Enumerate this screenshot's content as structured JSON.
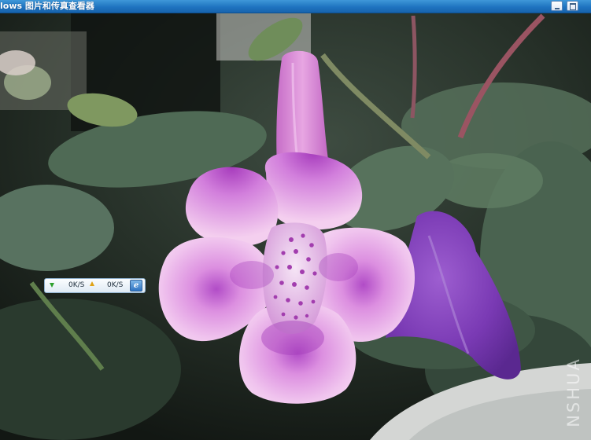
{
  "window": {
    "title": "lows 图片和传真查看器"
  },
  "speed_widget": {
    "download_speed": "0K/S",
    "upload_speed": "0K/S"
  },
  "watermark": {
    "text": "NSHUA"
  },
  "icons": {
    "download": "download-arrow-icon",
    "upload": "upload-arrow-icon",
    "browser": "internet-explorer-icon"
  },
  "colors": {
    "titlebar": "#1f74c0",
    "flower_pink": "#d98fd6",
    "flower_purple": "#8a3fb0",
    "leaf_green": "#4a6a50"
  }
}
